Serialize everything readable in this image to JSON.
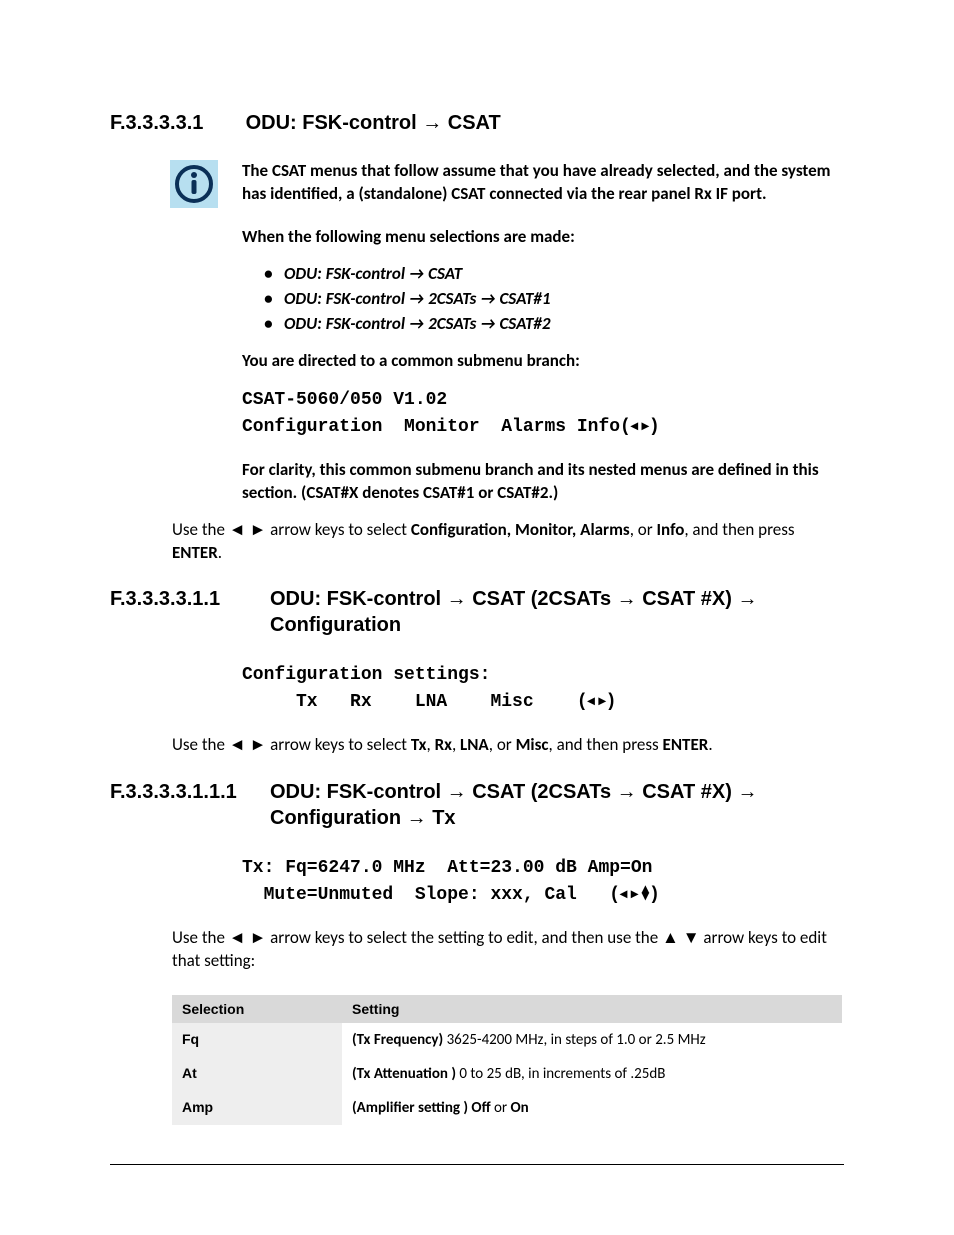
{
  "h1": {
    "num": "F.3.3.3.3.1",
    "title_a": "ODU: FSK-control ",
    "title_b": " CSAT"
  },
  "info": {
    "p1": "The CSAT menus that follow assume that you have already selected, and the system has identified, a (standalone) CSAT connected via the rear panel Rx IF port.",
    "p2": "When the following menu selections are made:",
    "bullets": {
      "b1_a": "ODU: FSK-control ",
      "b1_b": " CSAT",
      "b2_a": "ODU: FSK-control ",
      "b2_b": " 2CSATs ",
      "b2_c": " CSAT#1",
      "b3_a": "ODU: FSK-control ",
      "b3_b": " 2CSATs ",
      "b3_c": " CSAT#2"
    },
    "p3": "You are directed to a common submenu branch:",
    "mono1_l1": "CSAT-5060/050 V1.02",
    "mono1_l2a": "Configuration  Monitor  Alarms Info(",
    "mono1_l2b": ")",
    "p4": "For clarity, this common submenu branch and its nested menus are defined in this section. (CSAT#X denotes CSAT#1 or CSAT#2.)"
  },
  "para1": {
    "a": "Use the ",
    "b": " arrow keys to select ",
    "c": "Configuration, Monitor, Alarms",
    "d": ", or ",
    "e": "Info",
    "f": ", and then press ",
    "g": "ENTER",
    "h": "."
  },
  "h2": {
    "num": "F.3.3.3.3.1.1",
    "title_a": "ODU: FSK-control ",
    "title_b": " CSAT (2CSATs ",
    "title_c": " CSAT #X) ",
    "title_d": " Configuration"
  },
  "mono2": {
    "l1": "Configuration settings:",
    "l2a": "     Tx   Rx    LNA    Misc    (",
    "l2b": ")"
  },
  "para2": {
    "a": "Use the ",
    "b": " arrow keys to select ",
    "c": "Tx",
    "d": ", ",
    "e": "Rx",
    "f": ", ",
    "g": "LNA",
    "h": ", or ",
    "i": "Misc",
    "j": ", and then press ",
    "k": "ENTER",
    "l": "."
  },
  "h3": {
    "num": "F.3.3.3.3.1.1.1",
    "title_a": "ODU: FSK-control ",
    "title_b": " CSAT (2CSATs ",
    "title_c": " CSAT #X) ",
    "title_d": " Configuration ",
    "title_e": " Tx"
  },
  "mono3": {
    "l1": "Tx: Fq=6247.0 MHz  Att=23.00 dB Amp=On",
    "l2a": "  Mute=Unmuted  Slope: xxx, Cal   (",
    "l2b": ")"
  },
  "para3": {
    "a": "Use the ",
    "b": " arrow keys to select the setting to edit, and then use the ",
    "c": " arrow keys to edit that setting:"
  },
  "table": {
    "head_sel": "Selection",
    "head_set": "Setting",
    "rows": [
      {
        "sel": "Fq",
        "bold": "(Tx Frequency)",
        "rest": " 3625-4200 MHz, in steps of 1.0 or 2.5 MHz"
      },
      {
        "sel": "At",
        "bold": "(Tx Attenuation )",
        "rest": " 0 to 25 dB, in increments of .25dB"
      },
      {
        "sel": "Amp",
        "bold": "(Amplifier setting ) Off",
        "rest": " or ",
        "bold2": "On"
      }
    ]
  }
}
